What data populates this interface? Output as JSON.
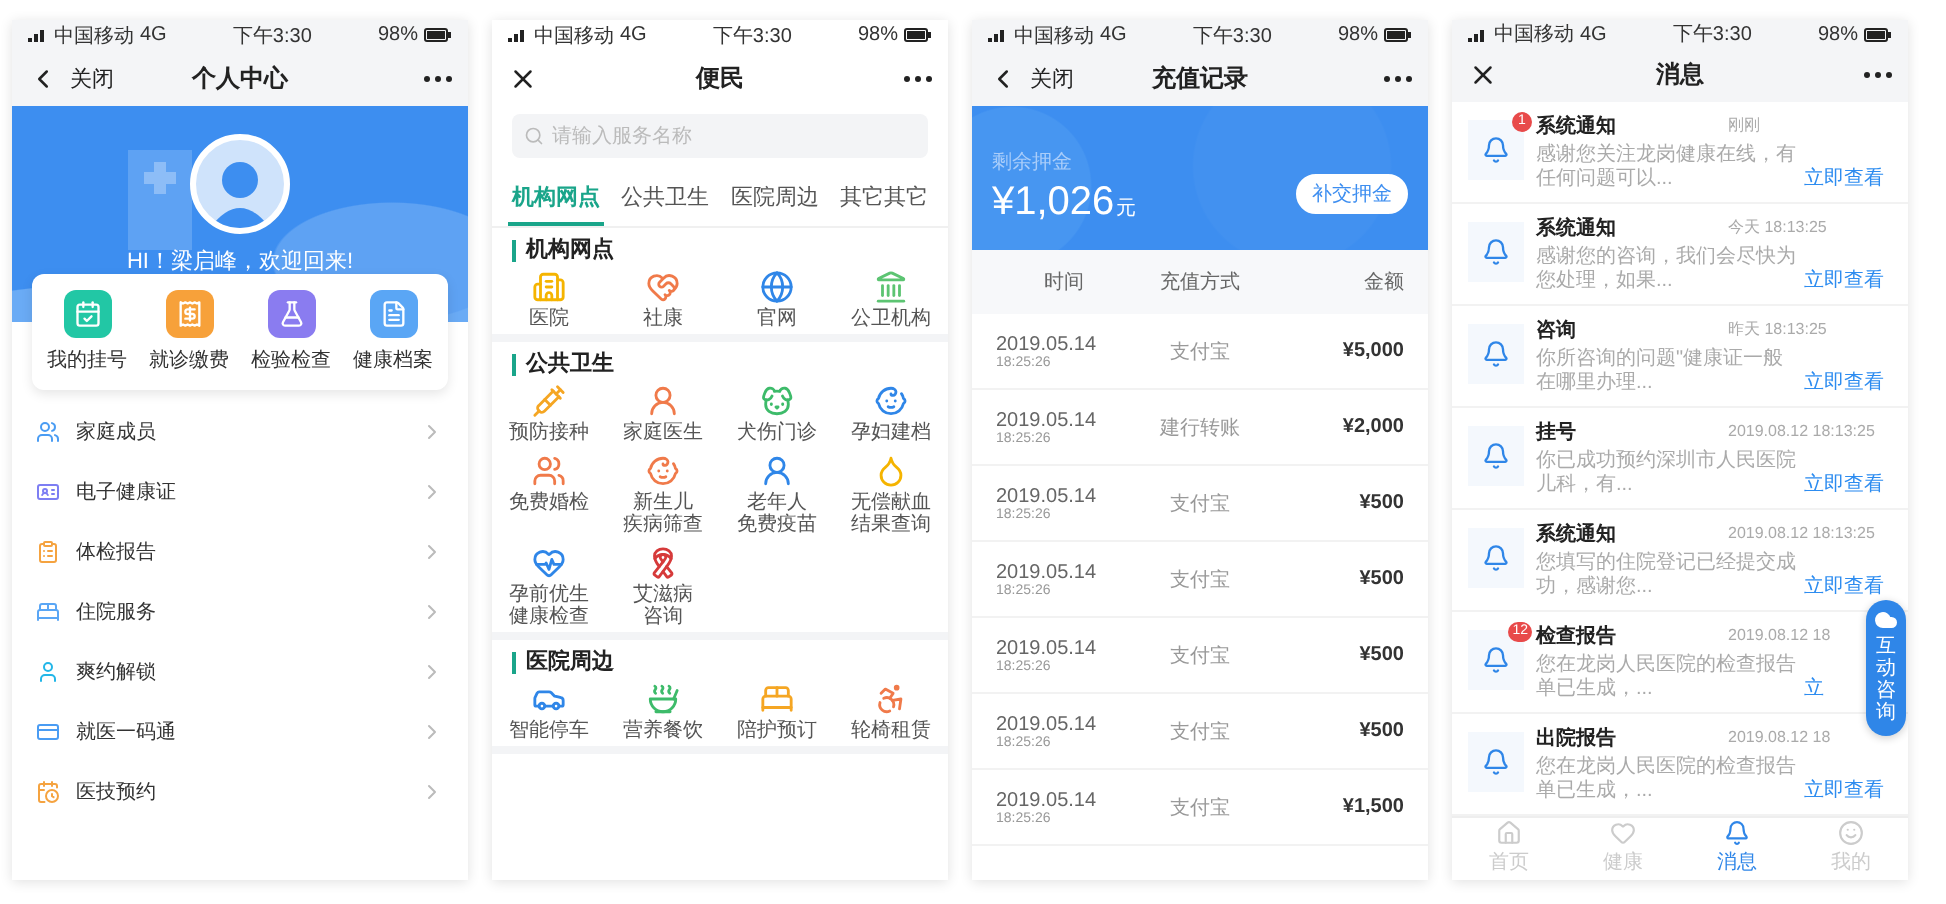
{
  "profile_screen": {
    "status_bar": {
      "carrier": "中国移动",
      "network": "4G",
      "time": "下午3:30",
      "battery": "98%"
    },
    "nav": {
      "close_label": "关闭",
      "title": "个人中心"
    },
    "greeting": "HI！梁启峰，欢迎回来!",
    "shortcuts": [
      "我的挂号",
      "就诊缴费",
      "检验检查",
      "健康档案"
    ],
    "menu": [
      "家庭成员",
      "电子健康证",
      "体检报告",
      "住院服务",
      "爽约解锁",
      "就医一码通",
      "医技预约"
    ]
  },
  "services_screen": {
    "status_bar": {
      "carrier": "中国移动",
      "network": "4G",
      "time": "下午3:30",
      "battery": "98%"
    },
    "nav": {
      "title": "便民"
    },
    "search": {
      "placeholder": "请输入服务名称"
    },
    "tabs": [
      {
        "label": "机构网点",
        "selected": true
      },
      {
        "label": "公共卫生",
        "selected": false
      },
      {
        "label": "医院周边",
        "selected": false
      },
      {
        "label": "其它其它",
        "selected": false
      }
    ],
    "sections": [
      {
        "title": "机构网点",
        "items": [
          [
            "医院"
          ],
          [
            "社康"
          ],
          [
            "官网"
          ],
          [
            "公卫机构"
          ]
        ]
      },
      {
        "title": "公共卫生",
        "items": [
          [
            "预防接种"
          ],
          [
            "家庭医生"
          ],
          [
            "犬伤门诊"
          ],
          [
            "孕妇建档"
          ],
          [
            "免费婚检"
          ],
          [
            "新生儿",
            "疾病筛查"
          ],
          [
            "老年人",
            "免费疫苗"
          ],
          [
            "无偿献血",
            "结果查询"
          ],
          [
            "孕前优生",
            "健康检查"
          ],
          [
            "艾滋病",
            "咨询"
          ]
        ]
      },
      {
        "title": "医院周边",
        "items": [
          [
            "智能停车"
          ],
          [
            "营养餐饮"
          ],
          [
            "陪护预订"
          ],
          [
            "轮椅租赁"
          ]
        ]
      }
    ]
  },
  "recharge_screen": {
    "status_bar": {
      "carrier": "中国移动",
      "network": "4G",
      "time": "下午3:30",
      "battery": "98%"
    },
    "nav": {
      "close_label": "关闭",
      "title": "充值记录"
    },
    "balance": {
      "label": "剩余押金",
      "amount": "¥1,026",
      "unit": "元",
      "button": "补交押金"
    },
    "columns": [
      "时间",
      "充值方式",
      "金额"
    ],
    "rows": [
      {
        "date": "2019.05.14",
        "time": "18:25:26",
        "method": "支付宝",
        "amount": "¥5,000"
      },
      {
        "date": "2019.05.14",
        "time": "18:25:26",
        "method": "建行转账",
        "amount": "¥2,000"
      },
      {
        "date": "2019.05.14",
        "time": "18:25:26",
        "method": "支付宝",
        "amount": "¥500"
      },
      {
        "date": "2019.05.14",
        "time": "18:25:26",
        "method": "支付宝",
        "amount": "¥500"
      },
      {
        "date": "2019.05.14",
        "time": "18:25:26",
        "method": "支付宝",
        "amount": "¥500"
      },
      {
        "date": "2019.05.14",
        "time": "18:25:26",
        "method": "支付宝",
        "amount": "¥500"
      },
      {
        "date": "2019.05.14",
        "time": "18:25:26",
        "method": "支付宝",
        "amount": "¥1,500"
      }
    ]
  },
  "messages_screen": {
    "status_bar": {
      "carrier": "中国移动",
      "network": "4G",
      "time": "下午3:30",
      "battery": "98%"
    },
    "nav": {
      "title": "消息"
    },
    "messages": [
      {
        "title": "系统通知",
        "time": "刚刚",
        "preview": "感谢您关注龙岗健康在线，有任何问题可以...",
        "link": "立即查看",
        "badge": "1"
      },
      {
        "title": "系统通知",
        "time": "今天 18:13:25",
        "preview": "感谢您的咨询，我们会尽快为您处理，如果...",
        "link": "立即查看"
      },
      {
        "title": "咨询",
        "time": "昨天 18:13:25",
        "preview": "你所咨询的问题\"健康证一般在哪里办理...",
        "link": "立即查看"
      },
      {
        "title": "挂号",
        "time": "2019.08.12 18:13:25",
        "preview": "你已成功预约深圳市人民医院儿科，有...",
        "link": "立即查看"
      },
      {
        "title": "系统通知",
        "time": "2019.08.12 18:13:25",
        "preview": "您填写的住院登记已经提交成功，感谢您...",
        "link": "立即查看"
      },
      {
        "title": "检查报告",
        "time": "2019.08.12 18",
        "preview": "您在龙岗人民医院的检查报告单已生成，...",
        "link": "立",
        "badge": "12"
      },
      {
        "title": "出院报告",
        "time": "2019.08.12 18",
        "preview": "您在龙岗人民医院的检查报告单已生成，...",
        "link": "立即查看"
      }
    ],
    "floating_button": "互动咨询",
    "tab_bar": [
      {
        "label": "首页",
        "selected": false
      },
      {
        "label": "健康",
        "selected": false
      },
      {
        "label": "消息",
        "selected": true
      },
      {
        "label": "我的",
        "selected": false
      }
    ]
  }
}
